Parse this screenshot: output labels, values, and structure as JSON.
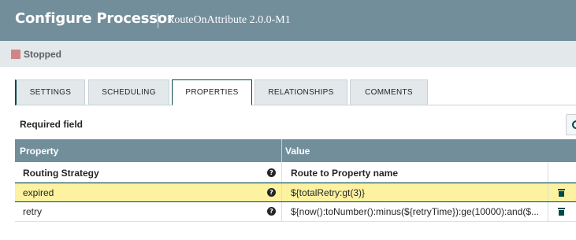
{
  "header": {
    "title": "Configure Processor",
    "subtitle": "RouteOnAttribute 2.0.0-M1"
  },
  "status": {
    "text": "Stopped",
    "color": "#d18686"
  },
  "tabs": [
    {
      "label": "SETTINGS",
      "active": false
    },
    {
      "label": "SCHEDULING",
      "active": false
    },
    {
      "label": "PROPERTIES",
      "active": true
    },
    {
      "label": "RELATIONSHIPS",
      "active": false
    },
    {
      "label": "COMMENTS",
      "active": false
    }
  ],
  "required_label": "Required field",
  "add_property_icon": "plus-circle-icon",
  "table": {
    "columns": [
      "Property",
      "Value"
    ],
    "rows": [
      {
        "property": "Routing Strategy",
        "value": "Route to Property name",
        "required": true,
        "help_icon": "help-icon"
      },
      {
        "property": "expired",
        "value": "${totalRetry:gt(3)}",
        "selected": true,
        "help_icon": "help-icon",
        "action_icon": "trash-icon"
      },
      {
        "property": "retry",
        "value": "${now():toNumber():minus(${retryTime}):ge(10000):and($...",
        "help_icon": "help-icon",
        "action_icon": "trash-icon"
      }
    ]
  },
  "colors": {
    "header_bg": "#728e9b",
    "accent": "#004849",
    "selected_row": "#fcf2a0"
  }
}
